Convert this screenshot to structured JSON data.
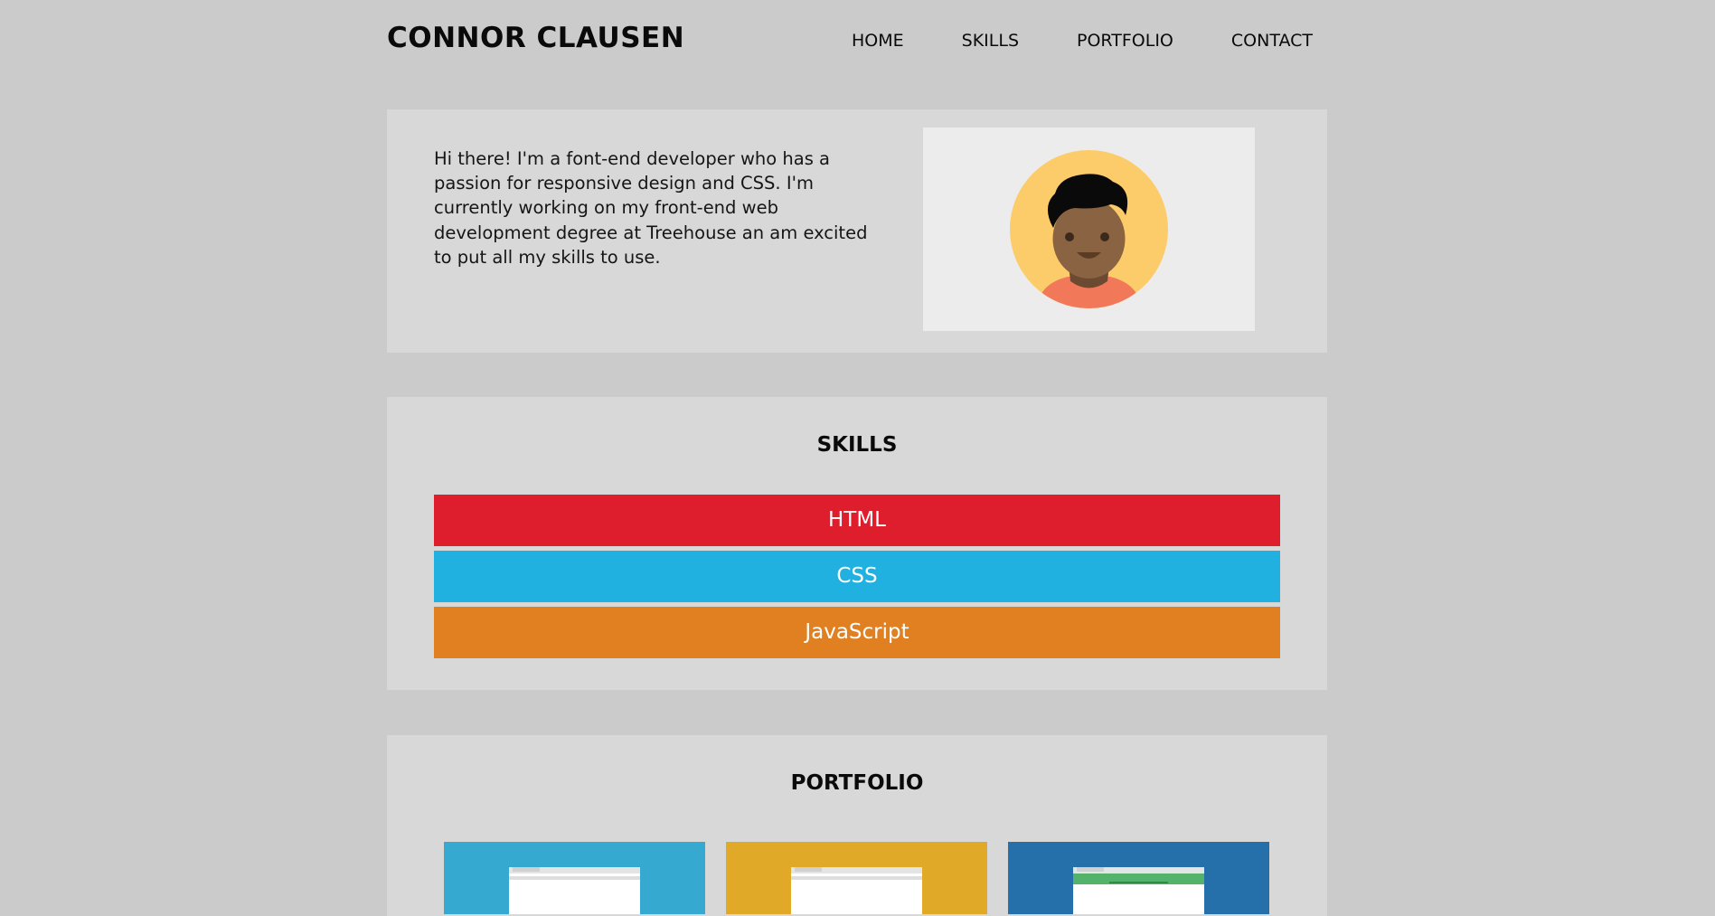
{
  "header": {
    "title": "CONNOR CLAUSEN",
    "nav": [
      "HOME",
      "SKILLS",
      "PORTFOLIO",
      "CONTACT"
    ]
  },
  "intro": {
    "text": "Hi there! I'm a font-end developer who has a passion for responsive design and CSS. I'm currently working on my front-end web development degree at Treehouse an am excited to put all my skills to use."
  },
  "skills": {
    "heading": "SKILLS",
    "items": [
      {
        "label": "HTML",
        "color": "#df1e2d"
      },
      {
        "label": "CSS",
        "color": "#20b1e0"
      },
      {
        "label": "JavaScript",
        "color": "#e08020"
      }
    ]
  },
  "portfolio": {
    "heading": "PORTFOLIO",
    "colors": [
      "#35a9d0",
      "#e0a928",
      "#2570aa"
    ]
  },
  "colors": {
    "background": "#cbcbcb",
    "panel": "#d8d8d8",
    "avatar_box": "#ececec",
    "avatar_circle": "#fdcc6a",
    "skin": "#8a6342",
    "hair": "#0a0a0a",
    "shirt": "#f2785a"
  }
}
